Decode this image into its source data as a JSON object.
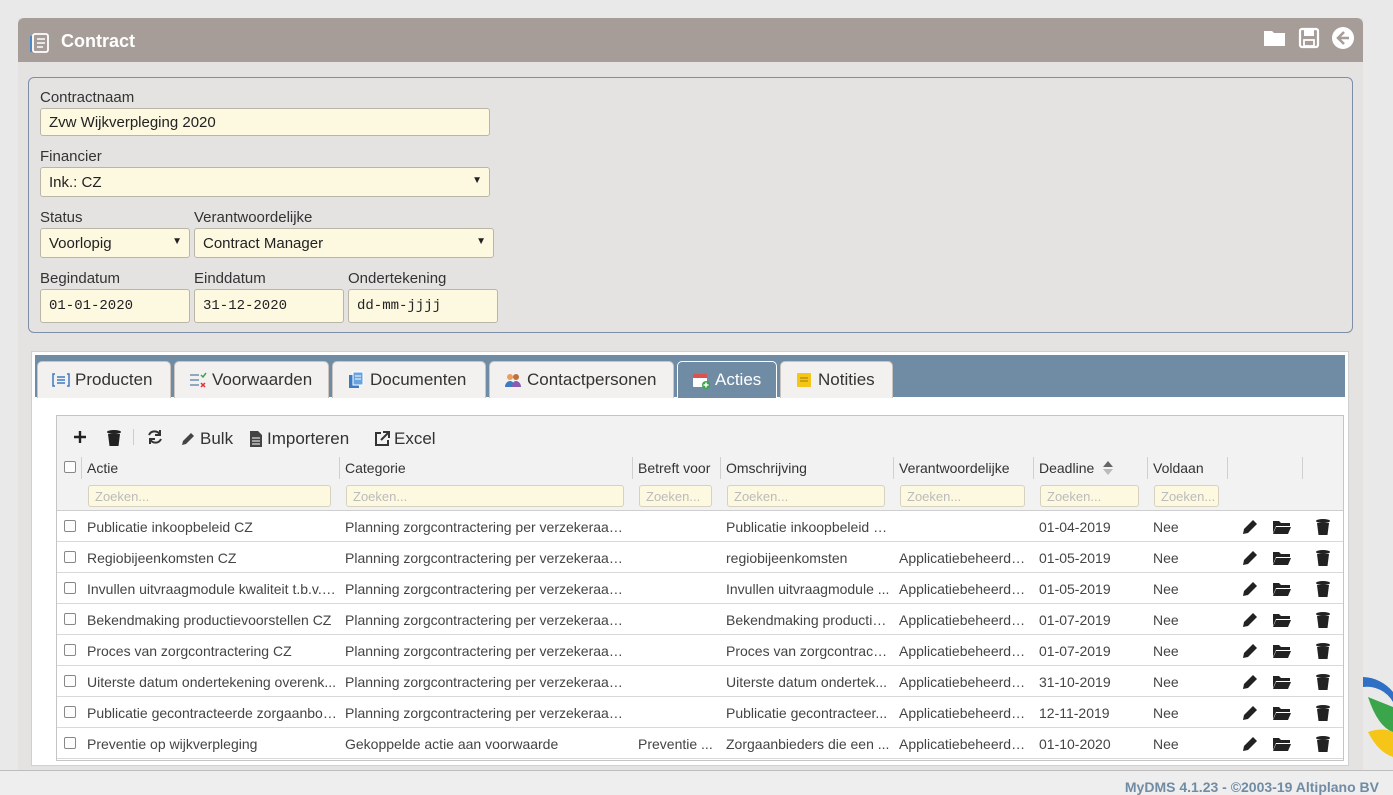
{
  "header": {
    "title": "Contract"
  },
  "form": {
    "contractnaam": {
      "label": "Contractnaam",
      "value": "Zvw Wijkverpleging 2020"
    },
    "financier": {
      "label": "Financier",
      "value": "Ink.: CZ"
    },
    "status": {
      "label": "Status",
      "value": "Voorlopig"
    },
    "verantwoordelijke": {
      "label": "Verantwoordelijke",
      "value": "Contract Manager"
    },
    "begindatum": {
      "label": "Begindatum",
      "value": "01-01-2020"
    },
    "einddatum": {
      "label": "Einddatum",
      "value": "31-12-2020"
    },
    "ondertekening": {
      "label": "Ondertekening",
      "value": "dd-mm-jjjj"
    }
  },
  "tabs": [
    {
      "label": "Producten"
    },
    {
      "label": "Voorwaarden"
    },
    {
      "label": "Documenten"
    },
    {
      "label": "Contactpersonen"
    },
    {
      "label": "Acties"
    },
    {
      "label": "Notities"
    }
  ],
  "toolbar": {
    "bulk": "Bulk",
    "importeren": "Importeren",
    "excel": "Excel"
  },
  "columns": [
    "Actie",
    "Categorie",
    "Betreft voor",
    "Omschrijving",
    "Verantwoordelijke",
    "Deadline",
    "Voldaan"
  ],
  "search_placeholder": "Zoeken...",
  "rows": [
    [
      "Publicatie inkoopbeleid CZ",
      "Planning zorgcontractering per verzekeraar ...",
      "",
      "Publicatie inkoopbeleid CZ",
      "",
      "01-04-2019",
      "Nee"
    ],
    [
      "Regiobijeenkomsten CZ",
      "Planning zorgcontractering per verzekeraar ...",
      "",
      "regiobijeenkomsten",
      "Applicatiebeheerde...",
      "01-05-2019",
      "Nee"
    ],
    [
      "Invullen uitvraagmodule kwaliteit t.b.v. ...",
      "Planning zorgcontractering per verzekeraar ...",
      "",
      "Invullen uitvraagmodule ...",
      "Applicatiebeheerde...",
      "01-05-2019",
      "Nee"
    ],
    [
      "Bekendmaking productievoorstellen CZ",
      "Planning zorgcontractering per verzekeraar ...",
      "",
      "Bekendmaking productie...",
      "Applicatiebeheerde...",
      "01-07-2019",
      "Nee"
    ],
    [
      "Proces van zorgcontractering CZ",
      "Planning zorgcontractering per verzekeraar ...",
      "",
      "Proces van zorgcontracte...",
      "Applicatiebeheerde...",
      "01-07-2019",
      "Nee"
    ],
    [
      "Uiterste datum ondertekening overenk...",
      "Planning zorgcontractering per verzekeraar ...",
      "",
      "Uiterste datum ondertek...",
      "Applicatiebeheerde...",
      "31-10-2019",
      "Nee"
    ],
    [
      "Publicatie gecontracteerde zorgaanbod...",
      "Planning zorgcontractering per verzekeraar ...",
      "",
      "Publicatie gecontracteer...",
      "Applicatiebeheerde...",
      "12-11-2019",
      "Nee"
    ],
    [
      "Preventie op wijkverpleging",
      "Gekoppelde actie aan voorwaarde",
      "Preventie ...",
      "Zorgaanbieders die een ...",
      "Applicatiebeheerde...",
      "01-10-2020",
      "Nee"
    ]
  ],
  "footer": {
    "text": "MyDMS 4.1.23 - ©2003-19 Altiplano BV"
  }
}
